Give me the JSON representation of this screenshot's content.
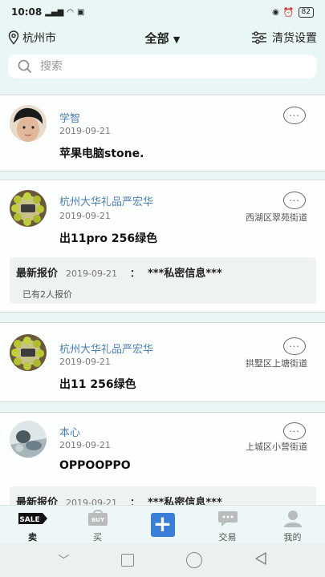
{
  "status_bar": {
    "time": "10:08",
    "battery": "82"
  },
  "header": {
    "city": "杭州市",
    "filter": "全部",
    "settings_label": "清货设置"
  },
  "search": {
    "placeholder": "搜索"
  },
  "posts": [
    {
      "name": "学智",
      "date": "2019-09-21",
      "title": "苹果电脑stone.",
      "location": ""
    },
    {
      "name": "杭州大华礼品严宏华",
      "date": "2019-09-21",
      "title": "出11pro 256绿色",
      "location": "西湖区翠苑街道",
      "quote": {
        "label": "最新报价",
        "date": "2019-09-21",
        "colon": "：",
        "info": "***私密信息***",
        "count": "已有2人报价"
      }
    },
    {
      "name": "杭州大华礼品严宏华",
      "date": "2019-09-21",
      "title": "出11 256绿色",
      "location": "拱墅区上塘街道"
    },
    {
      "name": "本心",
      "date": "2019-09-21",
      "title": "OPPOOPPO",
      "location": "上城区小营街道",
      "quote": {
        "label": "最新报价",
        "date": "2019-09-21",
        "colon": "：",
        "info": "***私密信息***"
      }
    }
  ],
  "tabbar": {
    "tabs": [
      {
        "label": "卖",
        "badge": "SALE"
      },
      {
        "label": "买",
        "badge": "BUY"
      },
      {
        "label": ""
      },
      {
        "label": "交易"
      },
      {
        "label": "我的"
      }
    ]
  },
  "colors": {
    "accent": "#3a7fd5",
    "name_link": "#4a7fb5",
    "background": "#e9f6f6"
  }
}
